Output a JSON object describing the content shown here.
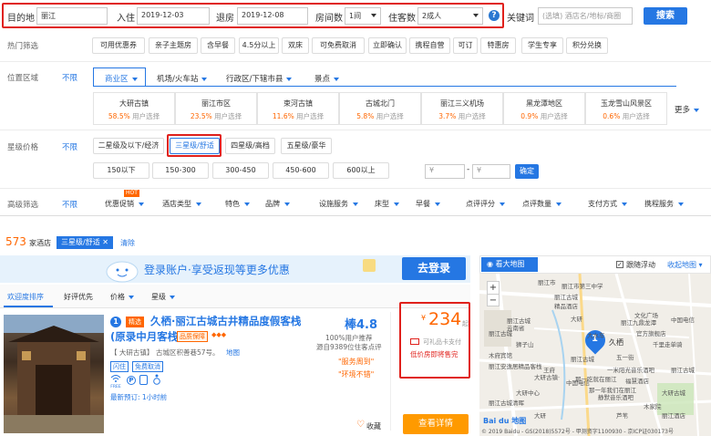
{
  "search": {
    "dest_label": "目的地",
    "dest_value": "丽江",
    "checkin_label": "入住",
    "checkin_value": "2019-12-03",
    "checkout_label": "退房",
    "checkout_value": "2019-12-08",
    "rooms_label": "房间数",
    "rooms_value": "1间",
    "guests_label": "住客数",
    "guests_value": "2成人",
    "help": "?",
    "keyword_label": "关键词",
    "keyword_placeholder": "(选填) 酒店名/地标/商圈",
    "search_btn": "搜索"
  },
  "hot": {
    "label": "热门筛选",
    "items": [
      "可用优惠券",
      "亲子主题房",
      "含早餐",
      "4.5分以上",
      "双床",
      "可免费取消",
      "立即确认",
      "携程自营",
      "可订",
      "特惠房",
      "学生专享",
      "积分兑换"
    ]
  },
  "location": {
    "label": "位置区域",
    "any": "不限",
    "tabs": [
      "商业区",
      "机场/火车站",
      "行政区/下辖市县",
      "景点"
    ],
    "cells": [
      {
        "name": "大研古镇",
        "pct": "58.5%",
        "suffix": "用户选择"
      },
      {
        "name": "丽江市区",
        "pct": "23.5%",
        "suffix": "用户选择"
      },
      {
        "name": "束河古镇",
        "pct": "11.6%",
        "suffix": "用户选择"
      },
      {
        "name": "古城北门",
        "pct": "5.8%",
        "suffix": "用户选择"
      },
      {
        "name": "丽江三义机场",
        "pct": "3.7%",
        "suffix": "用户选择"
      },
      {
        "name": "黑龙潭地区",
        "pct": "0.9%",
        "suffix": "用户选择"
      },
      {
        "name": "玉龙雪山风景区",
        "pct": "0.6%",
        "suffix": "用户选择"
      }
    ],
    "more": "更多"
  },
  "star": {
    "label": "星级价格",
    "any": "不限",
    "levels": [
      "二星级及以下/经济",
      "三星级/舒适",
      "四星级/高档",
      "五星级/豪华"
    ],
    "prices": [
      "150以下",
      "150-300",
      "300-450",
      "450-600",
      "600以上"
    ],
    "price_from_placeholder": "¥",
    "dash": "-",
    "price_to_placeholder": "¥",
    "confirm": "确定"
  },
  "advanced": {
    "label": "高级筛选",
    "any": "不限",
    "hot_badge": "HOT",
    "items": [
      "优惠促销",
      "酒店类型",
      "特色",
      "品牌",
      "设施服务",
      "床型",
      "早餐",
      "点评评分",
      "点评数量",
      "支付方式",
      "携程服务"
    ]
  },
  "results": {
    "count": "573",
    "count_suffix": "家酒店",
    "applied_tag": "三星级/舒适",
    "clear": "清除"
  },
  "banner": {
    "text": "登录账户·享受返现等更多优惠",
    "login_btn": "去登录"
  },
  "sort": {
    "tabs": [
      "欢迎度排序",
      "好评优先",
      "价格",
      "星级"
    ]
  },
  "hotel": {
    "index": "1",
    "badge": "精选",
    "name_line1": "久栖·丽江古城古井精品度假客栈",
    "name_line2": "(原录中月客栈)",
    "grade": "品质保障",
    "diamonds": "◆◆◆",
    "score": "棒4.8",
    "recommend": "100%用户推荐",
    "reviews": "源自9389位住客点评",
    "area_tag": "【 大研古镇】",
    "address": "古城区积善巷57号。",
    "map_link": "地图",
    "tags": [
      "闪住",
      "免费取消"
    ],
    "wifi": "FREE",
    "quote1": "\"服务周到\"",
    "quote2": "\"环境不错\"",
    "recent": "最新预订: 1小时前",
    "price_symbol": "¥",
    "price": "234",
    "price_suffix": "起",
    "gift_card": "可礼品卡支付",
    "low_price": "低价房即将售完",
    "favorite": "收藏",
    "view_btn": "查看详情"
  },
  "map": {
    "big_map": "看大地图",
    "follow": "跟随浮动",
    "collapse": "收起地图",
    "hotel_marker": "1",
    "hotel_name": "久栖",
    "copyright": "© 2019 Baidu - GS(2018)5572号 - 甲测资字1100930 - 京ICP证030173号",
    "logo": "Bai du 地图",
    "places": [
      "丽江市",
      "文化广场",
      "丽江市第三中学",
      "丽江古城",
      "精品酒店",
      "丽江古城",
      "官方旗舰店",
      "大水车",
      "丽江九鼎龙潭",
      "木府宾馆",
      "丽江古城",
      "云南省",
      "丽江安逸居精品客栈",
      "大研古镇·",
      "王府",
      "丽江古城",
      "一米阳光音乐酒吧",
      "那一吃就在丽江",
      "丽江古城",
      "千里走单骑",
      "中国电信",
      "那一年我们在丽江",
      "静默音乐酒吧",
      "木家院",
      "丽江酒店",
      "大研",
      "大研中心",
      "中国电信",
      "丽江古城清晖",
      "芦苇",
      "大研古城",
      "五一街",
      "福慧酒店",
      "狮子山",
      "大研"
    ]
  },
  "colors": {
    "accent": "#2577e3",
    "red": "#e0201b",
    "orange": "#f60"
  }
}
